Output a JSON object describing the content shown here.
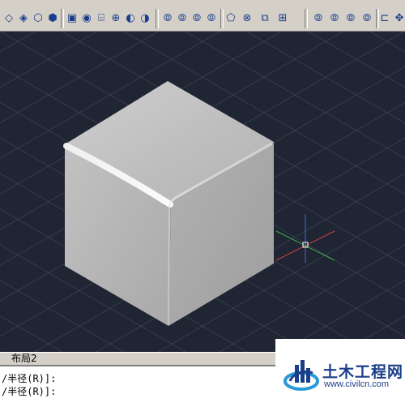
{
  "toolbar": {
    "icons": [
      "extrude-icon",
      "revolve-icon",
      "sweep-icon",
      "loft-icon",
      "box-icon",
      "sphere-icon",
      "cylinder-icon",
      "cone-icon",
      "union-icon",
      "subtract-icon",
      "intersect-icon",
      "orbit-icon",
      "pan-icon",
      "zoom-icon",
      "view-icon",
      "rotate-icon",
      "copy-icon",
      "move-icon",
      "union-icon-2",
      "subtract-icon-2",
      "intersect-icon-2",
      "orbit-icon-2",
      "shade-icon",
      "fillet-icon",
      "ucs-icon"
    ]
  },
  "tabs": {
    "layout2_label": "布局2"
  },
  "command": {
    "line1": "/半径(R)]:",
    "line2": "/半径(R)]:"
  },
  "watermark": {
    "title": "土木工程网",
    "url": "www.civilcn.com"
  }
}
